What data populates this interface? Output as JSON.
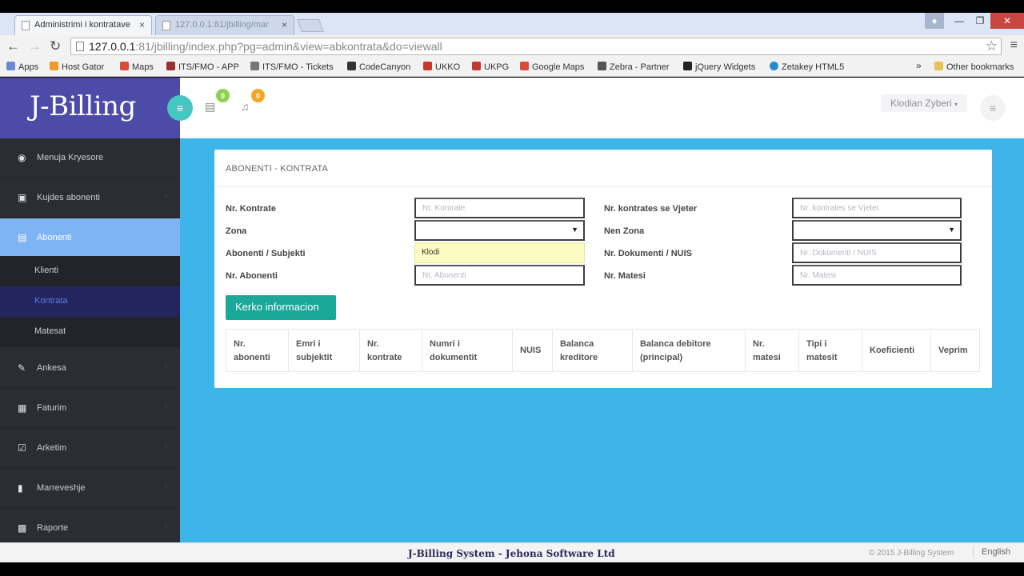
{
  "browser": {
    "tabs": [
      {
        "title": "Administrimi i kontratave",
        "close": "×"
      },
      {
        "title": "127.0.0.1:81/jbilling/mar",
        "close": "×"
      }
    ],
    "url_main": "127.0.0.1",
    "url_rest": ":81/jbilling/index.php?pg=admin&view=abkontrata&do=viewall",
    "bookmarks": [
      {
        "label": "Apps",
        "color": "#6b8ad6"
      },
      {
        "label": "Host Gator",
        "color": "#f19a2b"
      },
      {
        "label": "Maps",
        "color": "#d94b3b"
      },
      {
        "label": "ITS/FMO - APP",
        "color": "#9c2f2f"
      },
      {
        "label": "ITS/FMO - Tickets",
        "color": "#777777"
      },
      {
        "label": "CodeCanyon",
        "color": "#333333"
      },
      {
        "label": "UKKO",
        "color": "#c23a2b"
      },
      {
        "label": "UKPG",
        "color": "#c23a2b"
      },
      {
        "label": "Google Maps",
        "color": "#d94b3b"
      },
      {
        "label": "Zebra - Partner",
        "color": "#555555"
      },
      {
        "label": "jQuery Widgets",
        "color": "#222222"
      },
      {
        "label": "Zetakey HTML5",
        "color": "#2a8bc9"
      }
    ],
    "more_bookmarks": "»",
    "other_bookmarks": "Other bookmarks"
  },
  "app": {
    "logo": "J-Billing",
    "badges": {
      "messages": "0",
      "notifications": "0"
    },
    "user_name": "Klodian Zyberi",
    "menu": [
      {
        "label": "Menuja Kryesore"
      },
      {
        "label": "Kujdes abonenti"
      },
      {
        "label": "Abonenti"
      },
      {
        "label": "Ankesa"
      },
      {
        "label": "Faturim"
      },
      {
        "label": "Arketim"
      },
      {
        "label": "Marreveshje"
      },
      {
        "label": "Raporte"
      }
    ],
    "submenu": [
      {
        "label": "Klienti"
      },
      {
        "label": "Kontrata"
      },
      {
        "label": "Matesat"
      }
    ],
    "panel_title": "ABONENTI - KONTRATA",
    "form": {
      "nr_kontrate": {
        "label": "Nr. Kontrate",
        "placeholder": "Nr. Kontrate"
      },
      "nr_kontrates_vjeter": {
        "label": "Nr. kontrates se Vjeter",
        "placeholder": "Nr. kontrates se Vjeter"
      },
      "zona": {
        "label": "Zona",
        "value": ""
      },
      "nen_zona": {
        "label": "Nen Zona",
        "value": ""
      },
      "abonenti_subjekti": {
        "label": "Abonenti / Subjekti",
        "value": "Klodi"
      },
      "nr_dokumenti_nuis": {
        "label": "Nr. Dokumenti / NUIS",
        "placeholder": "Nr. Dokumenti / NUIS"
      },
      "nr_abonenti": {
        "label": "Nr. Abonenti",
        "placeholder": "Nr. Abonenti"
      },
      "nr_matesi": {
        "label": "Nr. Matesi",
        "placeholder": "Nr. Matesi"
      }
    },
    "search_button": "Kerko informacion",
    "table_headers": [
      [
        "Nr.",
        "abonenti"
      ],
      [
        "Emri i",
        "subjektit"
      ],
      [
        "Nr.",
        "kontrate"
      ],
      [
        "Numri i",
        "dokumentit"
      ],
      [
        "NUIS",
        ""
      ],
      [
        "Balanca",
        "kreditore"
      ],
      [
        "Balanca debitore",
        "(principal)"
      ],
      [
        "Nr.",
        "matesi"
      ],
      [
        "Tipi i",
        "matesit"
      ],
      [
        "Koeficienti",
        ""
      ],
      [
        "Veprim",
        ""
      ]
    ],
    "footer": {
      "center": "J-Billing System - Jehona Software Ltd",
      "copyright": "© 2015 J-Billing System",
      "language": "English"
    }
  },
  "colors": {
    "sidebar": "#2b2d33",
    "logo_bg": "#4c4ba8",
    "accent": "#3eb5e8",
    "button": "#1aa89a",
    "active_menu": "#7fb4f4"
  }
}
